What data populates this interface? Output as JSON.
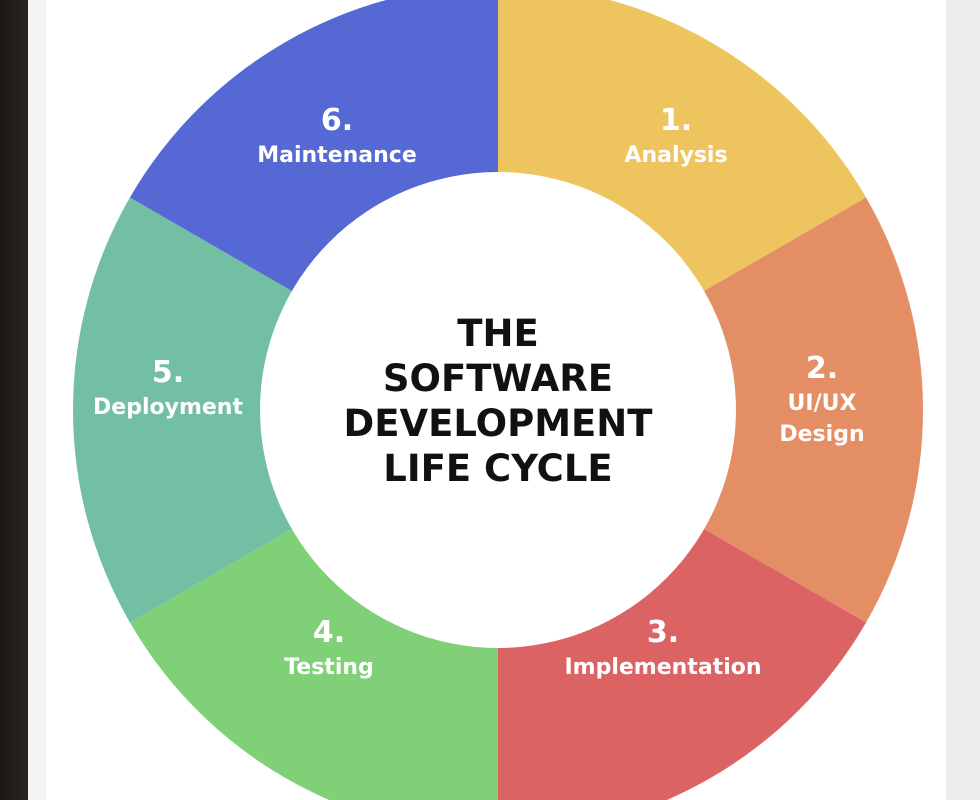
{
  "center_title": [
    "THE",
    "SOFTWARE",
    "DEVELOPMENT",
    "LIFE CYCLE"
  ],
  "segments": [
    {
      "number": "1.",
      "label_lines": [
        "Analysis"
      ],
      "color": "#eec45f"
    },
    {
      "number": "2.",
      "label_lines": [
        "UI/UX",
        "Design"
      ],
      "color": "#e48e66"
    },
    {
      "number": "3.",
      "label_lines": [
        "Implementation"
      ],
      "color": "#dc6363"
    },
    {
      "number": "4.",
      "label_lines": [
        "Testing"
      ],
      "color": "#7fd077"
    },
    {
      "number": "5.",
      "label_lines": [
        "Deployment"
      ],
      "color": "#72bfa3"
    },
    {
      "number": "6.",
      "label_lines": [
        "Maintenance"
      ],
      "color": "#5568d4"
    }
  ]
}
